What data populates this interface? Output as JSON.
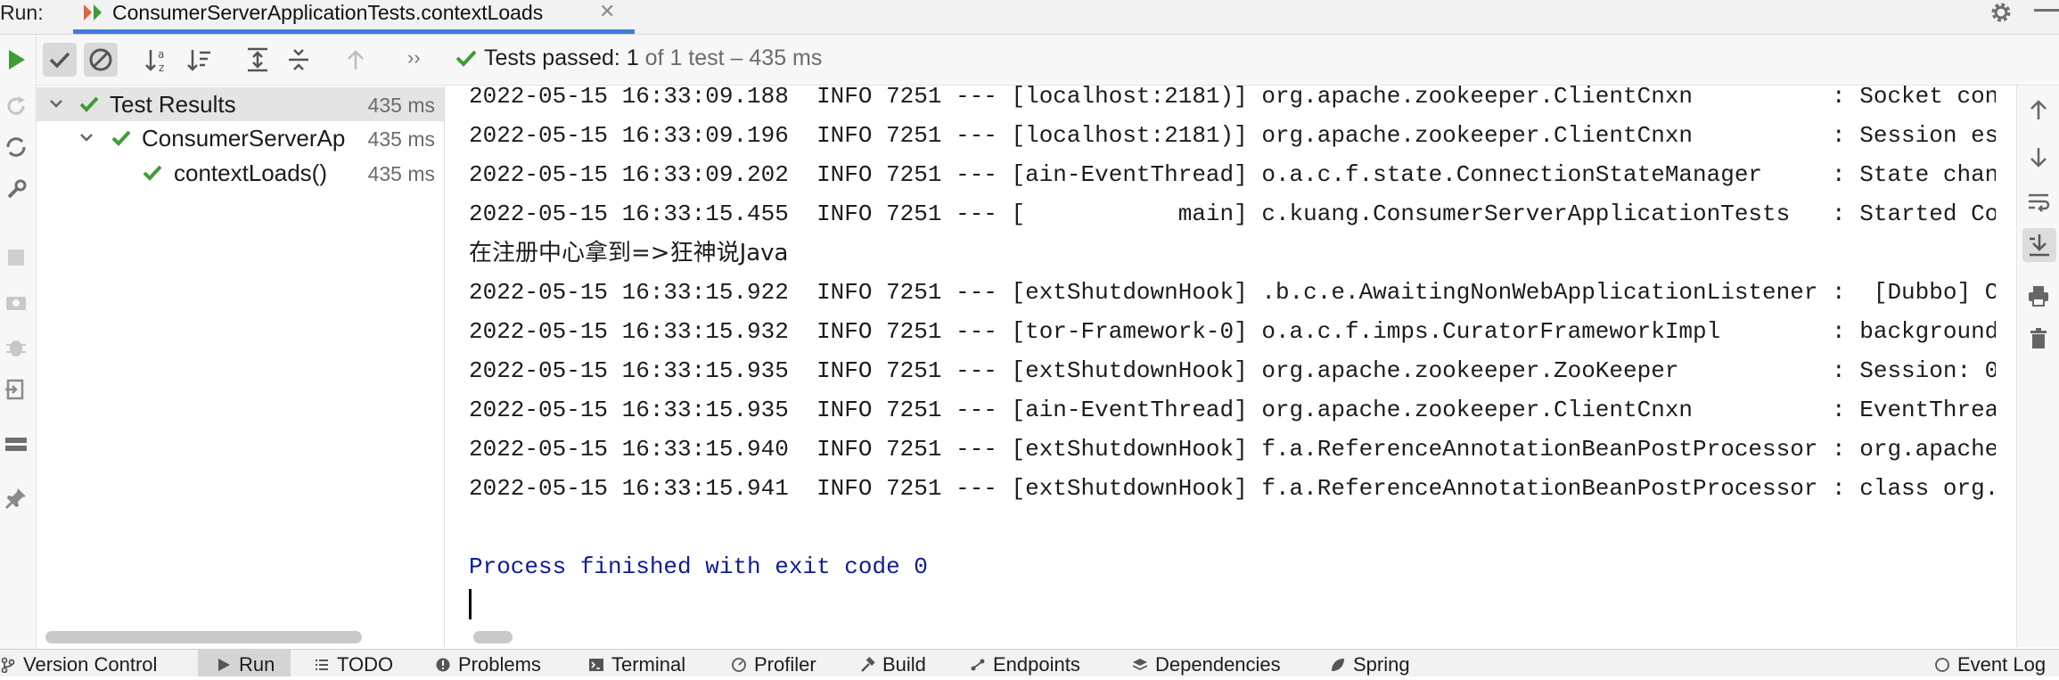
{
  "window": {
    "run_label": "Run:",
    "tab_title": "ConsumerServerApplicationTests.contextLoads",
    "accent_color": "#3d7ddb"
  },
  "toolbar": {
    "status_prefix": "Tests passed: ",
    "status_count": "1",
    "status_suffix": " of 1 test – 435 ms",
    "success_color": "#3f9c35"
  },
  "tree": {
    "items": [
      {
        "label": "Test Results",
        "time": "435 ms"
      },
      {
        "label": "ConsumerServerAp",
        "time": "435 ms"
      },
      {
        "label": "contextLoads()",
        "time": "435 ms"
      }
    ]
  },
  "console": {
    "lines": [
      "2022-05-15 16:33:09.188  INFO 7251 --- [localhost:2181)] org.apache.zookeeper.ClientCnxn          : Socket con",
      "2022-05-15 16:33:09.196  INFO 7251 --- [localhost:2181)] org.apache.zookeeper.ClientCnxn          : Session es",
      "2022-05-15 16:33:09.202  INFO 7251 --- [ain-EventThread] o.a.c.f.state.ConnectionStateManager     : State chan",
      "2022-05-15 16:33:15.455  INFO 7251 --- [           main] c.kuang.ConsumerServerApplicationTests   : Started Co",
      "在注册中心拿到=>狂神说Java",
      "2022-05-15 16:33:15.922  INFO 7251 --- [extShutdownHook] .b.c.e.AwaitingNonWebApplicationListener :  [Dubbo] C",
      "2022-05-15 16:33:15.932  INFO 7251 --- [tor-Framework-0] o.a.c.f.imps.CuratorFrameworkImpl        : background",
      "2022-05-15 16:33:15.935  INFO 7251 --- [extShutdownHook] org.apache.zookeeper.ZooKeeper           : Session: 0",
      "2022-05-15 16:33:15.935  INFO 7251 --- [ain-EventThread] org.apache.zookeeper.ClientCnxn          : EventThrea",
      "2022-05-15 16:33:15.940  INFO 7251 --- [extShutdownHook] f.a.ReferenceAnnotationBeanPostProcessor : org.apache",
      "2022-05-15 16:33:15.941  INFO 7251 --- [extShutdownHook] f.a.ReferenceAnnotationBeanPostProcessor : class org.",
      "",
      "Process finished with exit code 0"
    ],
    "finished_color": "#0b1c96"
  },
  "bottombar": {
    "items": [
      {
        "label": "Version Control",
        "icon": "branch-icon"
      },
      {
        "label": "Run",
        "icon": "play-icon"
      },
      {
        "label": "TODO",
        "icon": "list-icon"
      },
      {
        "label": "Problems",
        "icon": "warning-icon"
      },
      {
        "label": "Terminal",
        "icon": "terminal-icon"
      },
      {
        "label": "Profiler",
        "icon": "profiler-icon"
      },
      {
        "label": "Build",
        "icon": "hammer-icon"
      },
      {
        "label": "Endpoints",
        "icon": "endpoints-icon"
      },
      {
        "label": "Dependencies",
        "icon": "layers-icon"
      },
      {
        "label": "Spring",
        "icon": "leaf-icon"
      },
      {
        "label": "Event Log",
        "icon": "event-log-icon"
      }
    ]
  }
}
